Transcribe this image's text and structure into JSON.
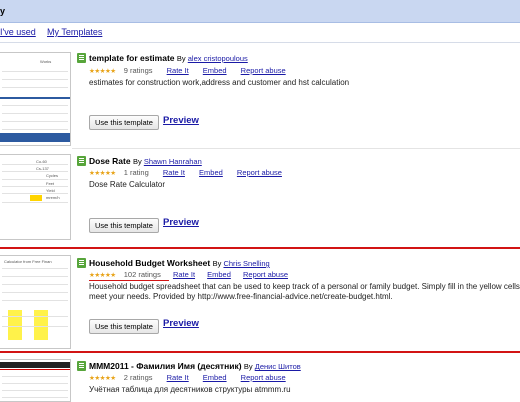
{
  "header": {
    "title": "y"
  },
  "tabs": [
    {
      "label": "I've used"
    },
    {
      "label": "My Templates"
    }
  ],
  "common": {
    "use_label": "Use this template",
    "preview_label": "Preview",
    "rate_label": "Rate It",
    "embed_label": "Embed",
    "report_label": "Report abuse",
    "by_label": "By"
  },
  "entries": [
    {
      "title": "template for estimate",
      "author": "alex cristopoulous",
      "stars": "★★★★★",
      "ratings": "9 ratings",
      "description": [
        "estimates for construction work,address and customer and hst calculation"
      ],
      "thumb_text": [
        "Works"
      ]
    },
    {
      "title": "Dose Rate",
      "author": "Shawn Hanrahan",
      "stars": "★★★★★",
      "ratings": "1 rating",
      "description": [
        "Dose Rate Calculator"
      ],
      "thumb_text": [
        "Co-60",
        "Cs-137",
        "Cycles",
        "Feet",
        "Yield",
        "mrem/h"
      ]
    },
    {
      "title": "Household Budget Worksheet",
      "author": "Chris Snelling",
      "stars": "★★★★★",
      "ratings": "102 ratings",
      "description": [
        "Household budget spreadsheet that can be used to keep track of a personal or family budget. Simply fill in the yellow cells",
        "meet your needs. Provided by http://www.free-financial-advice.net/create-budget.html."
      ],
      "thumb_text": [
        "Calculator from Free Finan"
      ]
    },
    {
      "title": "MMM2011 - Фамилия Имя (десятник)",
      "author": "Денис Шитов",
      "stars": "★★★★★",
      "ratings": "2 ratings",
      "description": [
        "Учётная таблица для десятников структуры atmmm.ru"
      ],
      "thumb_text": []
    }
  ]
}
